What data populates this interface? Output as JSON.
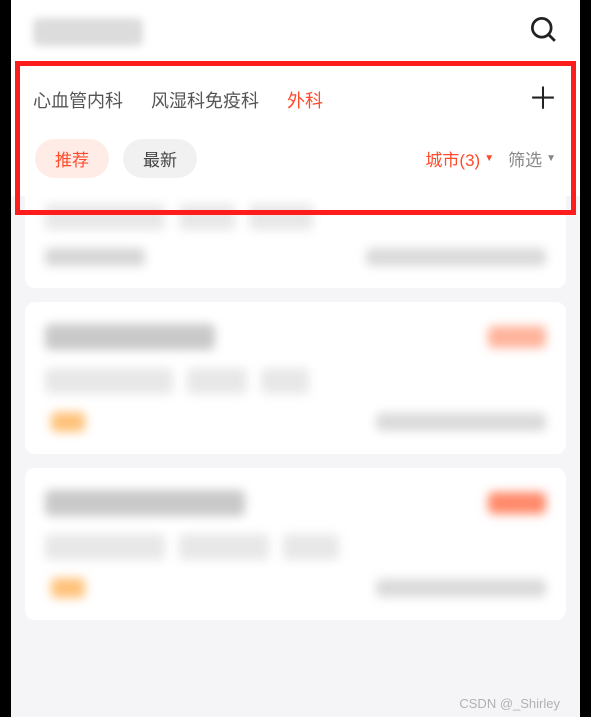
{
  "header": {
    "search_aria": "搜索"
  },
  "tabs": {
    "items": [
      {
        "label": "心血管内科",
        "active": false
      },
      {
        "label": "风湿科免疫科",
        "active": false
      },
      {
        "label": "外科",
        "active": true
      }
    ],
    "add_aria": "添加"
  },
  "filters": {
    "chips": [
      {
        "label": "推荐",
        "active": true
      },
      {
        "label": "最新",
        "active": false
      }
    ],
    "city_label": "城市(3)",
    "filter_label": "筛选"
  },
  "watermark": "CSDN @_Shirley"
}
